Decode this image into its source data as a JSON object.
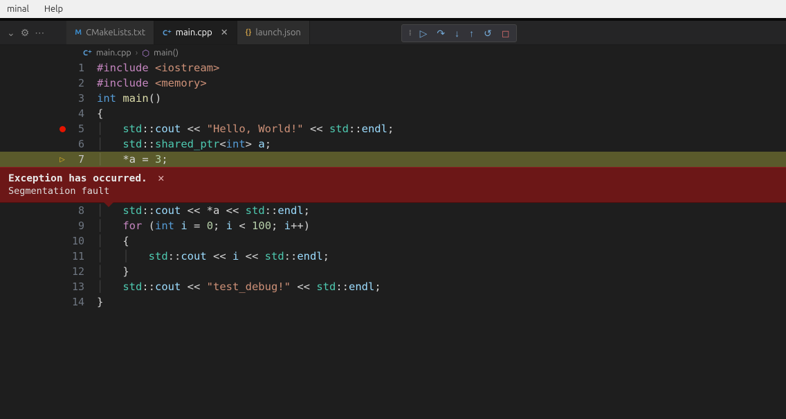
{
  "menubar": {
    "terminal": "minal",
    "help": "Help"
  },
  "tabs": {
    "cmakelists": {
      "label": "CMakeLists.txt",
      "icon": "M"
    },
    "main": {
      "label": "main.cpp",
      "icon": "C⁺"
    },
    "launch": {
      "label": "launch.json",
      "icon": "{}"
    }
  },
  "breadcrumb": {
    "file": "main.cpp",
    "symbol": "main()"
  },
  "exception": {
    "title": "Exception has occurred.",
    "message": "Segmentation fault"
  },
  "code": {
    "l1": {
      "n": "1",
      "a": "#include",
      "b": "<iostream>"
    },
    "l2": {
      "n": "2",
      "a": "#include",
      "b": "<memory>"
    },
    "l3": {
      "n": "3",
      "kw": "int",
      "fn": "main",
      "p": "()"
    },
    "l4": {
      "n": "4",
      "t": "{"
    },
    "l5": {
      "n": "5",
      "ns1": "std",
      "c1": "::",
      "v1": "cout",
      "op1": " << ",
      "str": "\"Hello, World!\"",
      "op2": " << ",
      "ns2": "std",
      "c2": "::",
      "v2": "endl",
      "end": ";"
    },
    "l6": {
      "n": "6",
      "ns": "std",
      "c": "::",
      "ty": "shared_ptr",
      "lt": "<",
      "kw": "int",
      "gt": ">",
      "sp": " ",
      "v": "a",
      "end": ";"
    },
    "l7": {
      "n": "7",
      "t": "*a = ",
      "num": "3",
      "end": ";"
    },
    "l8": {
      "n": "8",
      "ns1": "std",
      "c1": "::",
      "v1": "cout",
      "op1": " << ",
      "deref": "*a",
      "op2": " << ",
      "ns2": "std",
      "c2": "::",
      "v2": "endl",
      "end": ";"
    },
    "l9": {
      "n": "9",
      "kw": "for",
      "p1": " (",
      "ty": "int",
      "sp": " ",
      "v": "i",
      "eq": " = ",
      "n0": "0",
      "sc1": "; ",
      "v2": "i",
      "lt": " < ",
      "n100": "100",
      "sc2": "; ",
      "v3": "i",
      "pp": "++",
      "p2": ")"
    },
    "l10": {
      "n": "10",
      "t": "{"
    },
    "l11": {
      "n": "11",
      "ns1": "std",
      "c1": "::",
      "v1": "cout",
      "op1": " << ",
      "v": "i",
      "op2": " << ",
      "ns2": "std",
      "c2": "::",
      "v2": "endl",
      "end": ";"
    },
    "l12": {
      "n": "12",
      "t": "}"
    },
    "l13": {
      "n": "13",
      "ns1": "std",
      "c1": "::",
      "v1": "cout",
      "op1": " << ",
      "str": "\"test_debug!\"",
      "op2": " << ",
      "ns2": "std",
      "c2": "::",
      "v2": "endl",
      "end": ";"
    },
    "l14": {
      "n": "14",
      "t": "}"
    }
  }
}
